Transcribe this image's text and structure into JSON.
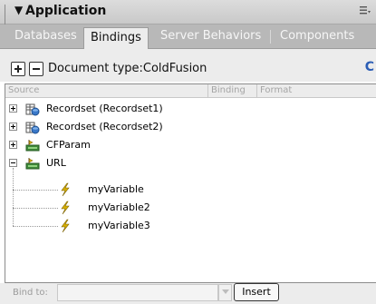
{
  "panel": {
    "title": "Application",
    "toggle_glyph": "▼"
  },
  "tabs": [
    {
      "label": "Databases",
      "active": false
    },
    {
      "label": "Bindings",
      "active": true
    },
    {
      "label": "Server Behaviors",
      "active": false
    },
    {
      "label": "Components",
      "active": false
    }
  ],
  "toolbar": {
    "document_type": "Document type:ColdFusion"
  },
  "grid": {
    "columns": [
      "Source",
      "Binding",
      "Format"
    ],
    "rows": [
      {
        "label": "Recordset (Recordset1)",
        "icon": "recordset-icon",
        "expanded": false
      },
      {
        "label": "Recordset (Recordset2)",
        "icon": "recordset-icon",
        "expanded": false
      },
      {
        "label": "CFParam",
        "icon": "cfparam-icon",
        "expanded": false
      },
      {
        "label": "URL",
        "icon": "url-icon",
        "expanded": true,
        "children": [
          "myVariable",
          "myVariable2",
          "myVariable3"
        ]
      }
    ]
  },
  "footer": {
    "bind_to_label": "Bind to:",
    "bind_to_value": "",
    "insert_label": "Insert"
  },
  "colors": {
    "tab_bar": "#b8b8b8",
    "panel_bg": "#ececec",
    "lightning": "#d8b000"
  }
}
